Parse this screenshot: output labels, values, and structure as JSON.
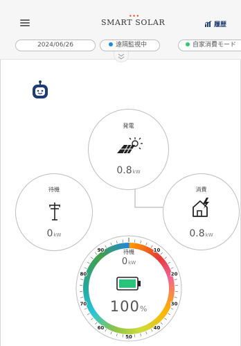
{
  "header": {
    "brand": "SMART S LAR",
    "brand_o": "O",
    "history_label": "履歴",
    "date": "2024/06/26",
    "status": "遠隔監視中",
    "mode": "自家消費モード"
  },
  "nodes": {
    "generation": {
      "label": "発電",
      "value": "0.8",
      "unit": "kW"
    },
    "standby": {
      "label": "待機",
      "value": "0",
      "unit": "kW"
    },
    "consumption": {
      "label": "消費",
      "value": "0.8",
      "unit": "kW"
    }
  },
  "battery": {
    "label": "待機",
    "power_value": "0",
    "power_unit": "kW",
    "charge_value": "100",
    "charge_unit": "%",
    "level": 1.0,
    "scale": [
      "10",
      "20",
      "30",
      "40",
      "50",
      "60",
      "70",
      "80",
      "90"
    ]
  },
  "colors": {
    "accent_navy": "#1f3b73",
    "solar_dots": "#e64a19",
    "status_blue": "#1e88e5",
    "status_green": "#2ecc71",
    "battery_green": "#27c47a"
  },
  "icons": {
    "menu": "menu-icon",
    "history": "bar-chart-icon",
    "expand": "chevron-down-icon",
    "assistant": "robot-icon",
    "generation": "solar-panel-icon",
    "standby": "power-pole-icon",
    "consumption": "house-lightning-icon",
    "battery": "battery-full-icon"
  }
}
